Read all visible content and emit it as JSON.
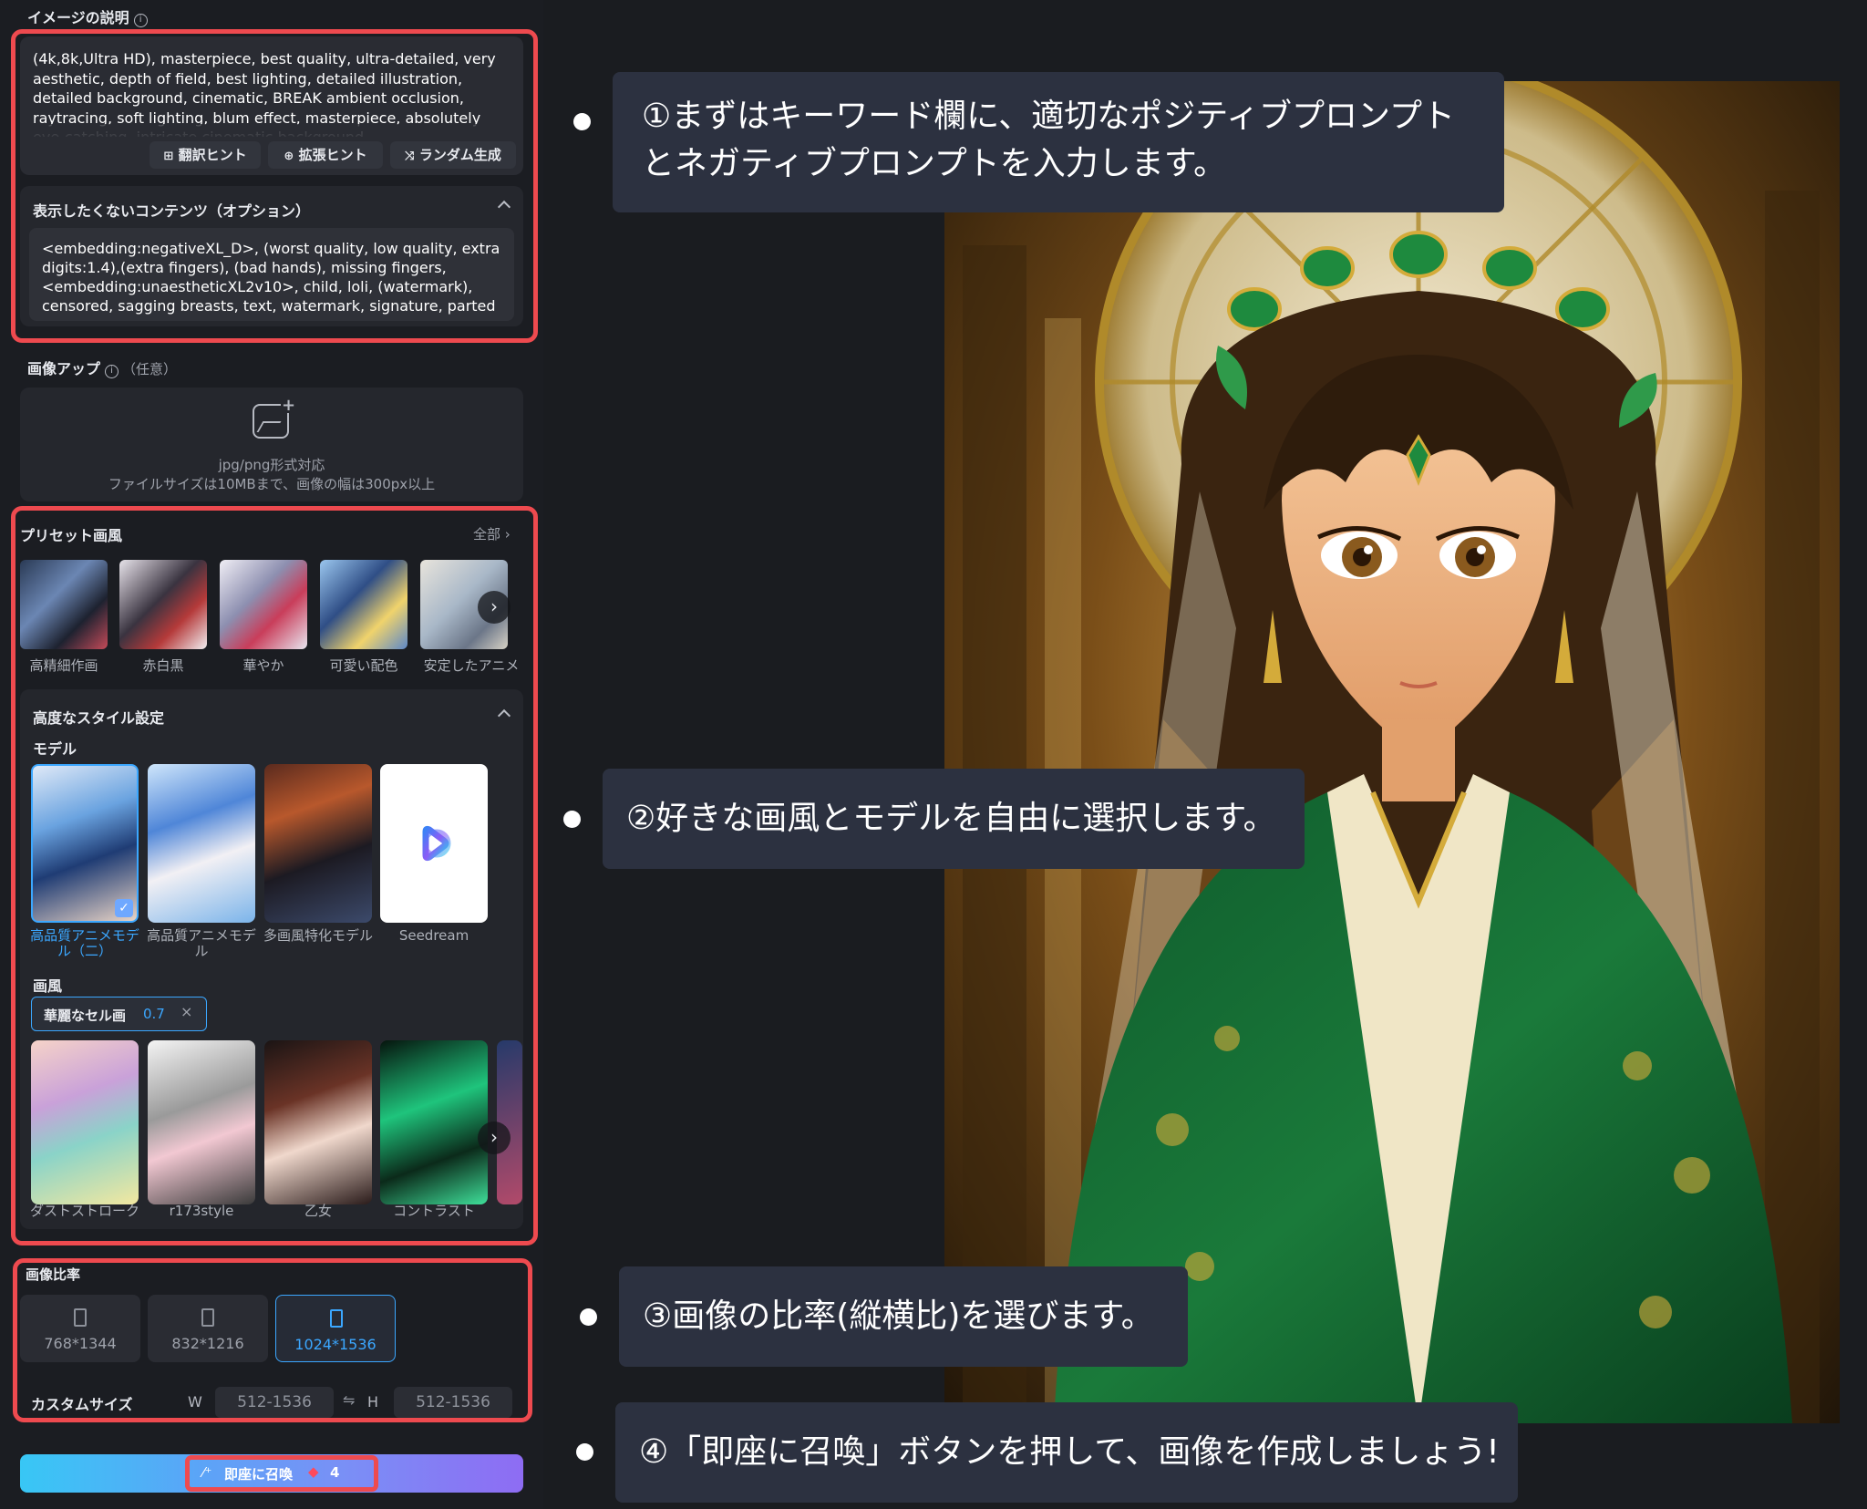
{
  "description_section": {
    "title": "イメージの説明",
    "prompt_text": "(4k,8k,Ultra HD), masterpiece, best quality, ultra-detailed, very aesthetic, depth of field, best lighting, detailed illustration, detailed background, cinematic, BREAK ambient occlusion, raytracing, soft lighting, blum effect, masterpiece, absolutely eye-catching, intricate cinematic background",
    "hint_buttons": [
      "翻訳ヒント",
      "拡張ヒント",
      "ランダム生成"
    ],
    "negative_title": "表示したくないコンテンツ（オプション）",
    "negative_text": "<embedding:negativeXL_D>, (worst quality, low quality, extra digits:1.4),(extra fingers), (bad hands), missing fingers, <embedding:unaestheticXL2v10>, child, loli, (watermark), censored, sagging breasts, text, watermark, signature, parted lips"
  },
  "upload_section": {
    "title": "画像アップ",
    "optional": "（任意）",
    "line1": "jpg/png形式対応",
    "line2": "ファイルサイズは10MBまで、画像の幅は300px以上"
  },
  "preset_section": {
    "title": "プリセット画風",
    "all_link": "全部",
    "items": [
      "高精細作画",
      "赤白黒",
      "華やか",
      "可愛い配色",
      "安定したアニメ"
    ]
  },
  "advanced_section": {
    "title": "高度なスタイル設定",
    "model_label": "モデル",
    "models": [
      "高品質アニメモデル（二）",
      "高品質アニメモデル",
      "多画風特化モデル",
      "Seedream"
    ],
    "style_label": "画風",
    "style_chip": {
      "name": "華麗なセル画",
      "value": "0.7"
    },
    "styles": [
      "ダストストローク",
      "r173style",
      "乙女",
      "コントラスト"
    ]
  },
  "ratio_section": {
    "title": "画像比率",
    "options": [
      "768*1344",
      "832*1216",
      "1024*1536"
    ],
    "custom_label": "カスタムサイズ",
    "w_label": "W",
    "h_label": "H",
    "w_range": "512-1536",
    "h_range": "512-1536",
    "swap_icon": "⇋"
  },
  "generate": {
    "label": "即座に召喚",
    "cost": "4"
  },
  "callouts": [
    "①まずはキーワード欄に、適切なポジティブプロンプトとネガティブプロンプトを入力します。",
    "②好きな画風とモデルを自由に選択します。",
    "③画像の比率(縦横比)を選びます。",
    "④「即座に召喚」ボタンを押して、画像を作成しましょう!"
  ],
  "colors": {
    "accent": "#3ba7ff",
    "highlight": "#ee4a4f",
    "panel": "#1b1d22"
  }
}
